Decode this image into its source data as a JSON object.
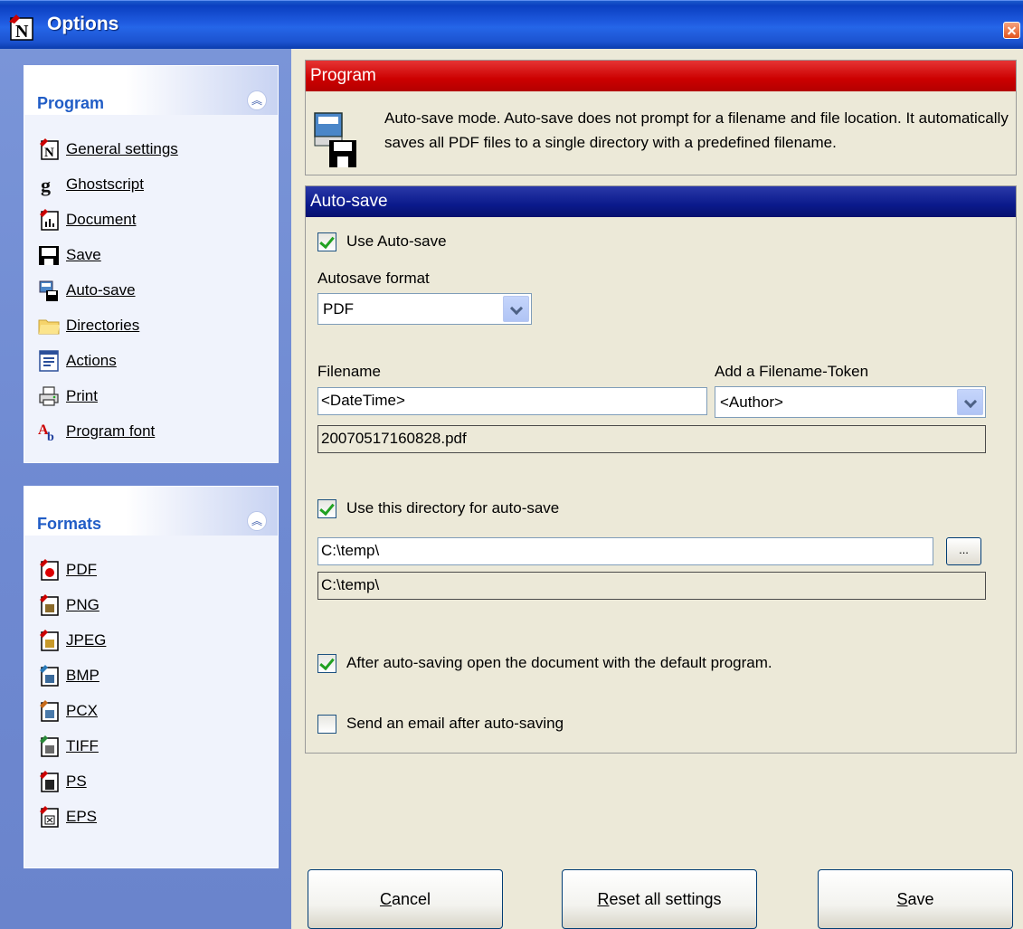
{
  "window": {
    "title": "Options"
  },
  "sidebar": {
    "program": {
      "title": "Program",
      "items": [
        {
          "label": "General settings",
          "icon": "program-icon"
        },
        {
          "label": "Ghostscript",
          "icon": "ghostscript-icon"
        },
        {
          "label": "Document",
          "icon": "document-icon"
        },
        {
          "label": "Save",
          "icon": "floppy-icon"
        },
        {
          "label": "Auto-save",
          "icon": "autosave-icon"
        },
        {
          "label": "Directories",
          "icon": "folder-icon"
        },
        {
          "label": "Actions",
          "icon": "actions-icon"
        },
        {
          "label": "Print",
          "icon": "printer-icon"
        },
        {
          "label": "Program font",
          "icon": "font-icon"
        }
      ]
    },
    "formats": {
      "title": "Formats",
      "items": [
        {
          "label": "PDF",
          "icon": "pdf-icon"
        },
        {
          "label": "PNG",
          "icon": "png-icon"
        },
        {
          "label": "JPEG",
          "icon": "jpeg-icon"
        },
        {
          "label": "BMP",
          "icon": "bmp-icon"
        },
        {
          "label": "PCX",
          "icon": "pcx-icon"
        },
        {
          "label": "TIFF",
          "icon": "tiff-icon"
        },
        {
          "label": "PS",
          "icon": "ps-icon"
        },
        {
          "label": "EPS",
          "icon": "eps-icon"
        }
      ]
    }
  },
  "program_section": {
    "title": "Program",
    "description": "Auto-save mode. Auto-save does not prompt for a filename and file location. It automatically saves all PDF files to a single directory with a predefined filename."
  },
  "autosave": {
    "title": "Auto-save",
    "use_autosave_label": "Use Auto-save",
    "use_autosave_checked": true,
    "format_label": "Autosave format",
    "format_value": "PDF",
    "filename_label": "Filename",
    "filename_value": "<DateTime>",
    "token_label": "Add a Filename-Token",
    "token_value": "<Author>",
    "filename_preview": "20070517160828.pdf",
    "use_directory_label": "Use this directory for auto-save",
    "use_directory_checked": true,
    "directory_value": "C:\\temp\\",
    "browse_label": "...",
    "directory_preview": "C:\\temp\\",
    "open_after_label": "After auto-saving open the document with the default program.",
    "open_after_checked": true,
    "send_email_label": "Send an email after auto-saving",
    "send_email_checked": false
  },
  "buttons": {
    "cancel_label": "Cancel",
    "reset_label": "Reset all settings",
    "save_label": "Save"
  },
  "colors": {
    "title_bar": "#2566e8",
    "program_header": "#cc0000",
    "autosave_header": "#0b1a8c",
    "sidebar_bg": "#6f8ad2",
    "panel_title": "#215dc6",
    "check_mark": "#21a121"
  }
}
